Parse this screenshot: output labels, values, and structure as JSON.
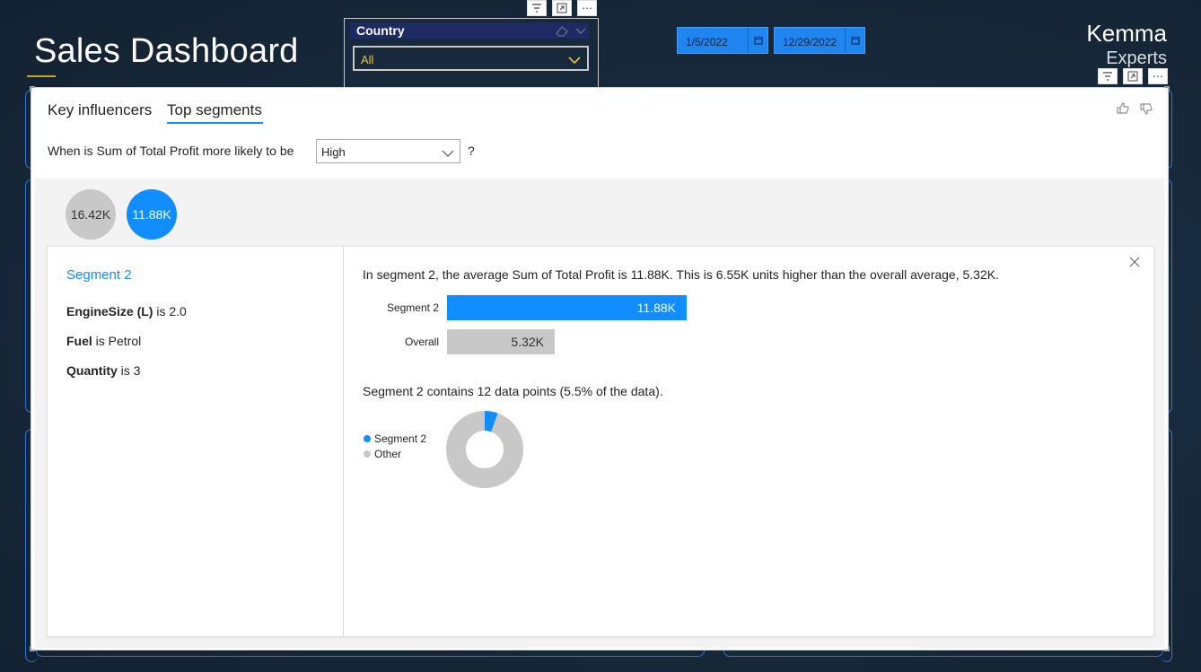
{
  "dashboard": {
    "title": "Sales Dashboard",
    "brand_line1": "Kemma",
    "brand_line2": "Experts"
  },
  "slicer": {
    "title": "Country",
    "value": "All"
  },
  "dates": {
    "start": "1/5/2022",
    "end": "12/29/2022"
  },
  "visual": {
    "tabs": [
      {
        "label": "Key influencers",
        "active": false
      },
      {
        "label": "Top segments",
        "active": true
      }
    ],
    "question_prefix": "When is Sum of Total Profit more likely to be",
    "question_value": "High",
    "question_suffix": "?",
    "bubbles": [
      {
        "label": "16.42K",
        "selected": false
      },
      {
        "label": "11.88K",
        "selected": true
      }
    ],
    "segment": {
      "title": "Segment 2",
      "conditions": [
        {
          "field": "EngineSize (L)",
          "text": " is 2.0"
        },
        {
          "field": "Fuel",
          "text": " is Petrol"
        },
        {
          "field": "Quantity",
          "text": " is 3"
        }
      ],
      "summary": "In segment 2, the average Sum of Total Profit is 11.88K. This is 6.55K units higher than the overall average, 5.32K.",
      "contains": "Segment 2 contains 12 data points (5.5% of the data)."
    },
    "colors": {
      "accent": "#118dff",
      "neutral": "#c8c8c8"
    }
  },
  "chart_data": [
    {
      "type": "bar",
      "categories": [
        "Segment 2",
        "Overall"
      ],
      "values": [
        11.88,
        5.32
      ],
      "value_labels": [
        "11.88K",
        "5.32K"
      ],
      "unit": "K"
    },
    {
      "type": "pie",
      "style": "donut",
      "labels": [
        "Segment 2",
        "Other"
      ],
      "values": [
        5.5,
        94.5
      ],
      "legend": "left"
    }
  ]
}
